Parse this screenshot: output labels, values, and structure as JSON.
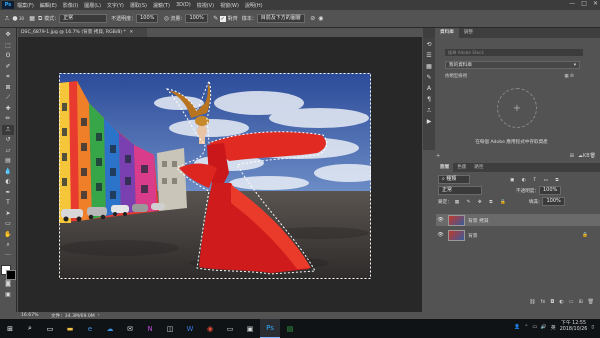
{
  "menu": {
    "logo": "Ps",
    "items": [
      "檔案(F)",
      "編輯(E)",
      "影像(I)",
      "圖層(L)",
      "文字(Y)",
      "選取(S)",
      "濾鏡(T)",
      "3D(D)",
      "檢視(V)",
      "視窗(W)",
      "說明(H)"
    ],
    "window_controls": [
      "—",
      "□",
      "✕"
    ]
  },
  "options": {
    "brush_size": "30",
    "mode_label": "模式：",
    "mode_value": "正常",
    "opacity_label": "不透明度：",
    "opacity_value": "100%",
    "flow_label": "流量：",
    "flow_value": "100%",
    "align_label": "對齊",
    "sample_label": "樣本：",
    "sample_value": "目前及下方的圖層"
  },
  "document": {
    "tab_title": "DSC_6879-1.jpg @ 16.7% (背景 拷貝, RGB/8) *",
    "zoom": "16.67%",
    "file_info": "文件：34.3M/69.0M"
  },
  "panels": {
    "tabs": [
      "資料庫",
      "調整"
    ],
    "search_placeholder": "搜尋 Adobe Stock",
    "library_select": "我的資料庫",
    "view_by": "依類型檢視",
    "empty_message": "在每個 Adobe 應用程式中存取資產",
    "library_size": "KB"
  },
  "layers": {
    "tabs": [
      "圖層",
      "色版",
      "路徑"
    ],
    "filter_label": "種類",
    "blend_mode": "正常",
    "opacity_label": "不透明度：",
    "opacity_value": "100%",
    "lock_label": "鎖定：",
    "fill_label": "填滿：",
    "fill_value": "100%",
    "items": [
      {
        "name": "背景 拷貝",
        "selected": true
      },
      {
        "name": "背景",
        "selected": false
      }
    ]
  },
  "taskbar": {
    "tray_lang": "英",
    "time": "下午 12:55",
    "date": "2018/10/26"
  },
  "accent_color": "#31a8ff"
}
